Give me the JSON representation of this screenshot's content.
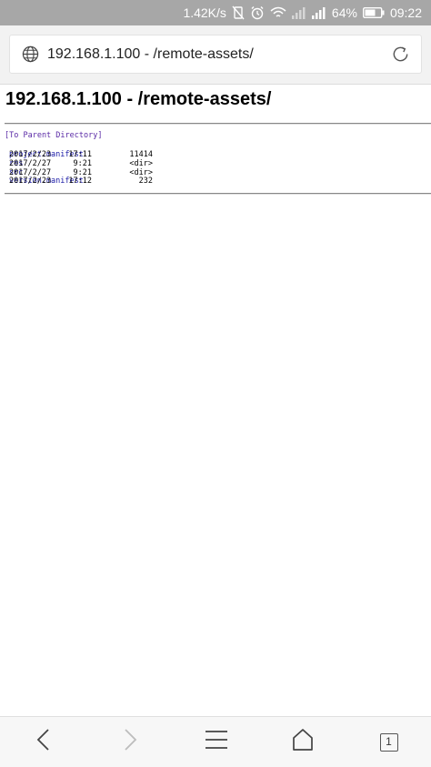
{
  "status_bar": {
    "speed": "1.42K/s",
    "battery": "64%",
    "time": "09:22"
  },
  "browser": {
    "address": "192.168.1.100 - /remote-assets/",
    "tab_count": "1"
  },
  "page": {
    "title": "192.168.1.100 - /remote-assets/",
    "parent_link": "[To Parent Directory]",
    "entries": [
      {
        "date": "2017/2/23",
        "time": "17:11",
        "size": "11414",
        "name": "project.manifest"
      },
      {
        "date": "2017/2/27",
        "time": "9:21",
        "size": "<dir>",
        "name": "res"
      },
      {
        "date": "2017/2/27",
        "time": "9:21",
        "size": "<dir>",
        "name": "src"
      },
      {
        "date": "2017/2/23",
        "time": "17:12",
        "size": "232",
        "name": "version.manifest"
      }
    ]
  },
  "icons": {
    "status": [
      "mute-icon",
      "alarm-icon",
      "wifi-icon",
      "signal-weak-icon",
      "signal-icon",
      "battery-icon"
    ],
    "toolbar": [
      "back-icon",
      "forward-icon",
      "menu-icon",
      "home-icon",
      "tabs-icon"
    ]
  },
  "colors": {
    "status_bar": "#a7a7a7",
    "link": "#1a1aa6",
    "visited_link": "#5a2aa6"
  }
}
